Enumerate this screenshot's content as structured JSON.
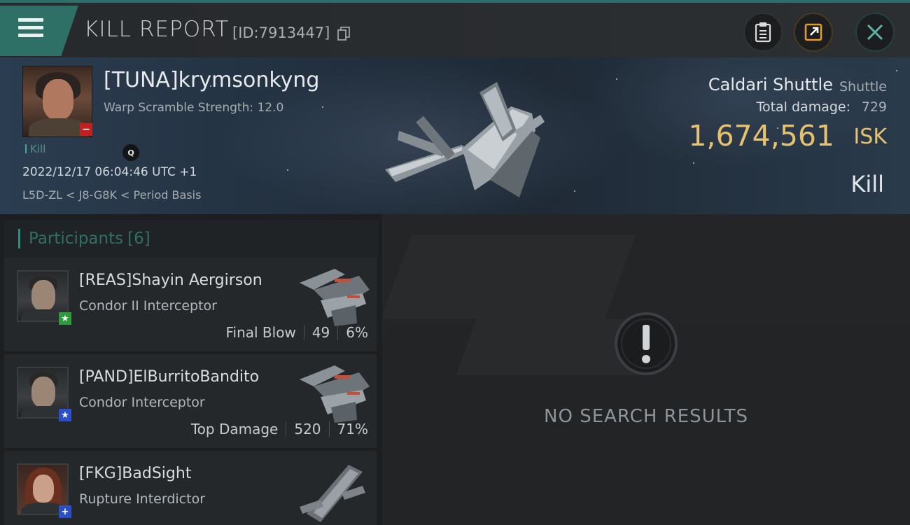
{
  "header": {
    "title": "KILL REPORT",
    "report_id": "[ID:7913447]",
    "icons": {
      "menu": "hamburger-menu-icon",
      "copy": "copy-icon",
      "notes": "clipboard-icon",
      "share": "share-icon",
      "close": "close-icon"
    },
    "colors": {
      "accent": "#2e6f66",
      "share_border": "#e39a2a"
    }
  },
  "victim": {
    "name": "[TUNA]krymsonkyng",
    "warp_scramble": "Warp Scramble Strength: 12.0",
    "kill_tag": "Kill",
    "search_icon": "Q",
    "datetime": "2022/12/17 06:04:46 UTC +1",
    "location": "L5D-ZL < J8-G8K < Period Basis",
    "ship_name": "Caldari Shuttle",
    "ship_class": "Shuttle",
    "total_damage_label": "Total damage:",
    "total_damage": "729",
    "isk_value": "1,674,561",
    "isk_unit": "ISK",
    "result": "Kill",
    "badge": "−"
  },
  "participants": {
    "label": "Participants",
    "count": "[6]",
    "items": [
      {
        "name": "[REAS]Shayin Aergirson",
        "ship": "Condor II Interceptor",
        "role": "Final Blow",
        "damage": "49",
        "percent": "6%",
        "badge": "★",
        "badge_color": "#2e9b3a"
      },
      {
        "name": "[PAND]ElBurritoBandito",
        "ship": "Condor Interceptor",
        "role": "Top Damage",
        "damage": "520",
        "percent": "71%",
        "badge": "★",
        "badge_color": "#2a4fc7"
      },
      {
        "name": "[FKG]BadSight",
        "ship": "Rupture Interdictor",
        "badge": "+",
        "badge_color": "#2a4fc7"
      }
    ]
  },
  "results": {
    "empty_text": "NO SEARCH RESULTS",
    "icon": "exclamation-circle-icon"
  }
}
